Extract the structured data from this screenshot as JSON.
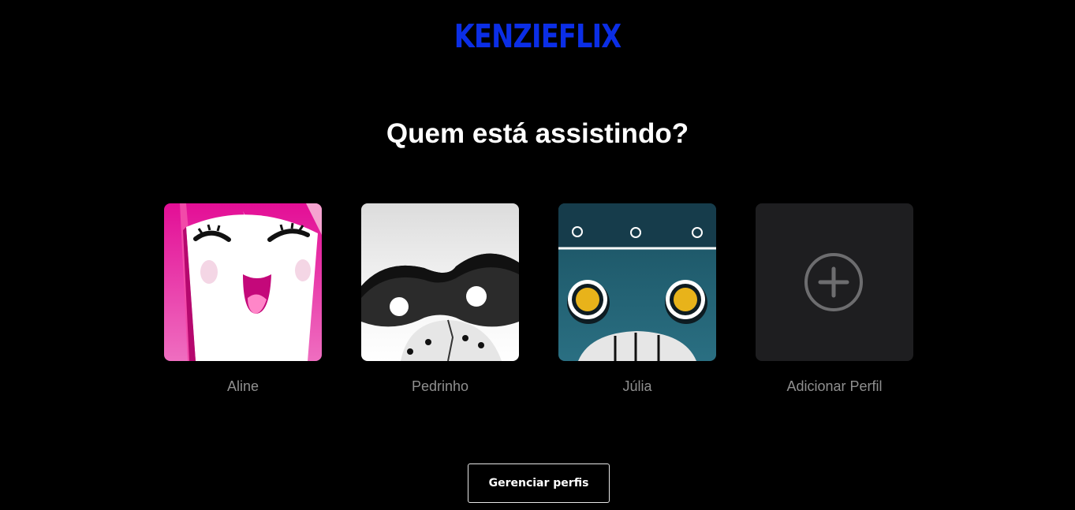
{
  "brand": {
    "logo_text": "KENZIEFLIX",
    "color": "#0b2ee6"
  },
  "heading": "Quem está assistindo?",
  "profiles": [
    {
      "name": "Aline",
      "avatar_icon": "pink-smiling-face-icon",
      "color": "#e8129a"
    },
    {
      "name": "Pedrinho",
      "avatar_icon": "masked-raccoon-face-icon",
      "color": "#ffffff"
    },
    {
      "name": "Júlia",
      "avatar_icon": "teal-robot-face-icon",
      "color": "#1b4f60"
    }
  ],
  "add_profile": {
    "label": "Adicionar Perfil",
    "icon": "plus-circle-icon"
  },
  "manage_button": {
    "label": "Gerenciar perfis"
  },
  "colors": {
    "background": "#000000",
    "profile_name": "#8f8f8f",
    "add_tile": "#1e1e20"
  }
}
